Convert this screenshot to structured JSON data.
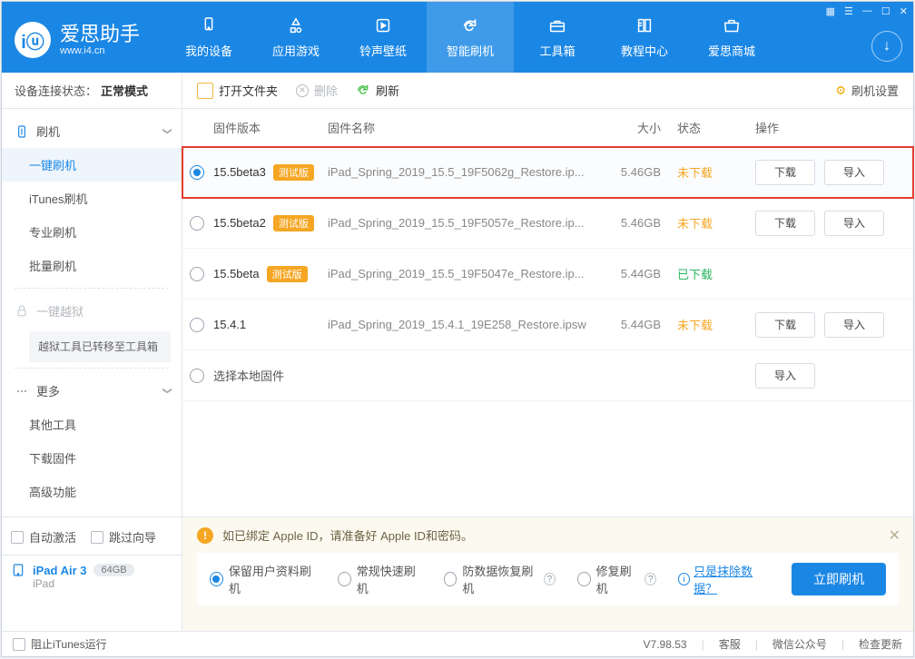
{
  "brand": {
    "name": "爱思助手",
    "url": "www.i4.cn"
  },
  "nav": [
    {
      "label": "我的设备"
    },
    {
      "label": "应用游戏"
    },
    {
      "label": "铃声壁纸"
    },
    {
      "label": "智能刷机"
    },
    {
      "label": "工具箱"
    },
    {
      "label": "教程中心"
    },
    {
      "label": "爱思商城"
    }
  ],
  "device_state_label": "设备连接状态：",
  "device_state_value": "正常模式",
  "toolbar": {
    "open_folder": "打开文件夹",
    "delete": "删除",
    "refresh": "刷新",
    "settings": "刷机设置"
  },
  "table_headers": {
    "version": "固件版本",
    "name": "固件名称",
    "size": "大小",
    "status": "状态",
    "ops": "操作"
  },
  "beta_badge": "测试版",
  "status": {
    "not": "未下载",
    "done": "已下载"
  },
  "buttons": {
    "download": "下载",
    "import": "导入"
  },
  "rows": [
    {
      "version": "15.5beta3",
      "badge": true,
      "name": "iPad_Spring_2019_15.5_19F5062g_Restore.ip...",
      "size": "5.46GB",
      "status": "not",
      "highlight": true,
      "selected": true,
      "show_dl": true,
      "show_imp": true
    },
    {
      "version": "15.5beta2",
      "badge": true,
      "name": "iPad_Spring_2019_15.5_19F5057e_Restore.ip...",
      "size": "5.46GB",
      "status": "not",
      "show_dl": true,
      "show_imp": true
    },
    {
      "version": "15.5beta",
      "badge": true,
      "name": "iPad_Spring_2019_15.5_19F5047e_Restore.ip...",
      "size": "5.44GB",
      "status": "done"
    },
    {
      "version": "15.4.1",
      "badge": false,
      "name": "iPad_Spring_2019_15.4.1_19E258_Restore.ipsw",
      "size": "5.44GB",
      "status": "not",
      "show_dl": true,
      "show_imp": true
    },
    {
      "version": "选择本地固件",
      "local": true,
      "badge": false,
      "name": "",
      "size": "",
      "status": "",
      "show_imp": true
    }
  ],
  "sidebar": {
    "root": "刷机",
    "items": [
      "一键刷机",
      "iTunes刷机",
      "专业刷机",
      "批量刷机"
    ],
    "jailbreak": "一键越狱",
    "note": "越狱工具已转移至工具箱",
    "more": "更多",
    "more_items": [
      "其他工具",
      "下载固件",
      "高级功能"
    ]
  },
  "bottom": {
    "auto_activate": "自动激活",
    "skip_guide": "跳过向导",
    "device": "iPad Air 3",
    "capacity": "64GB",
    "device_sub": "iPad",
    "notice": "如已绑定 Apple ID，请准备好 Apple ID和密码。",
    "opts": [
      "保留用户资料刷机",
      "常规快速刷机",
      "防数据恢复刷机",
      "修复刷机"
    ],
    "erase_link": "只是抹除数据？",
    "flash": "立即刷机"
  },
  "footer": {
    "itunes": "阻止iTunes运行",
    "ver_label": "V",
    "version": "7.98.53",
    "svc": "客服",
    "wechat": "微信公众号",
    "update": "检查更新"
  }
}
